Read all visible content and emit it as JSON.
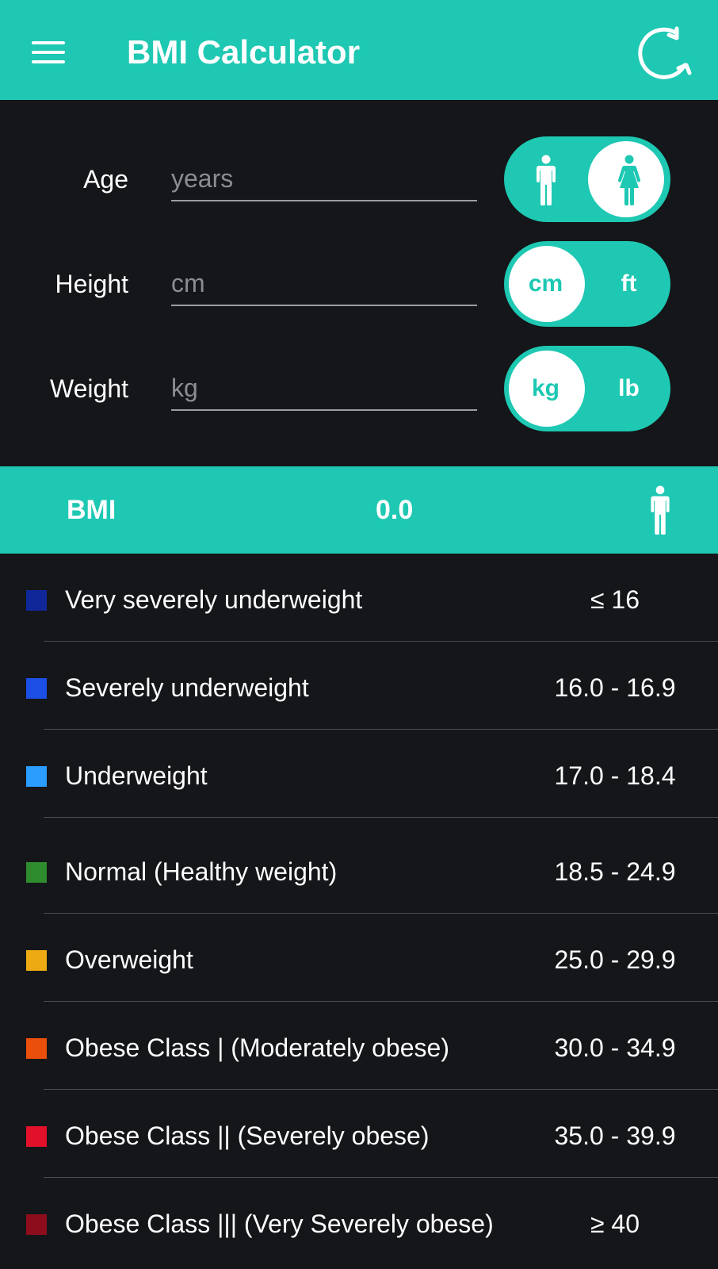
{
  "app_bar": {
    "title": "BMI Calculator",
    "menu_icon": "hamburger-menu-icon",
    "refresh_icon": "refresh-icon",
    "color": "#1ec8b2"
  },
  "form": {
    "age": {
      "label": "Age",
      "placeholder": "years",
      "value": ""
    },
    "height": {
      "label": "Height",
      "placeholder": "cm",
      "value": ""
    },
    "weight": {
      "label": "Weight",
      "placeholder": "kg",
      "value": ""
    },
    "gender_toggle": {
      "options": [
        "male",
        "female"
      ],
      "selected": "female"
    },
    "height_unit_toggle": {
      "options": [
        "cm",
        "ft"
      ],
      "selected": "cm"
    },
    "weight_unit_toggle": {
      "options": [
        "kg",
        "lb"
      ],
      "selected": "kg"
    }
  },
  "result": {
    "label": "BMI",
    "value": "0.0",
    "icon": "male-figure-icon"
  },
  "categories": [
    {
      "name": "Very severely underweight",
      "range": "≤ 16",
      "color": "#10279a"
    },
    {
      "name": "Severely underweight",
      "range": "16.0 - 16.9",
      "color": "#1b4fe6"
    },
    {
      "name": "Underweight",
      "range": "17.0 - 18.4",
      "color": "#2b9dff"
    },
    {
      "name": "Normal (Healthy weight)",
      "range": "18.5 - 24.9",
      "color": "#2e8b2e"
    },
    {
      "name": "Overweight",
      "range": "25.0 - 29.9",
      "color": "#eeaa12"
    },
    {
      "name": "Obese Class | (Moderately obese)",
      "range": "30.0 - 34.9",
      "color": "#ea4f0c"
    },
    {
      "name": "Obese Class || (Severely obese)",
      "range": "35.0 - 39.9",
      "color": "#e3102a"
    },
    {
      "name": "Obese Class ||| (Very Severely obese)",
      "range": "≥ 40",
      "color": "#8e0d1d"
    }
  ]
}
